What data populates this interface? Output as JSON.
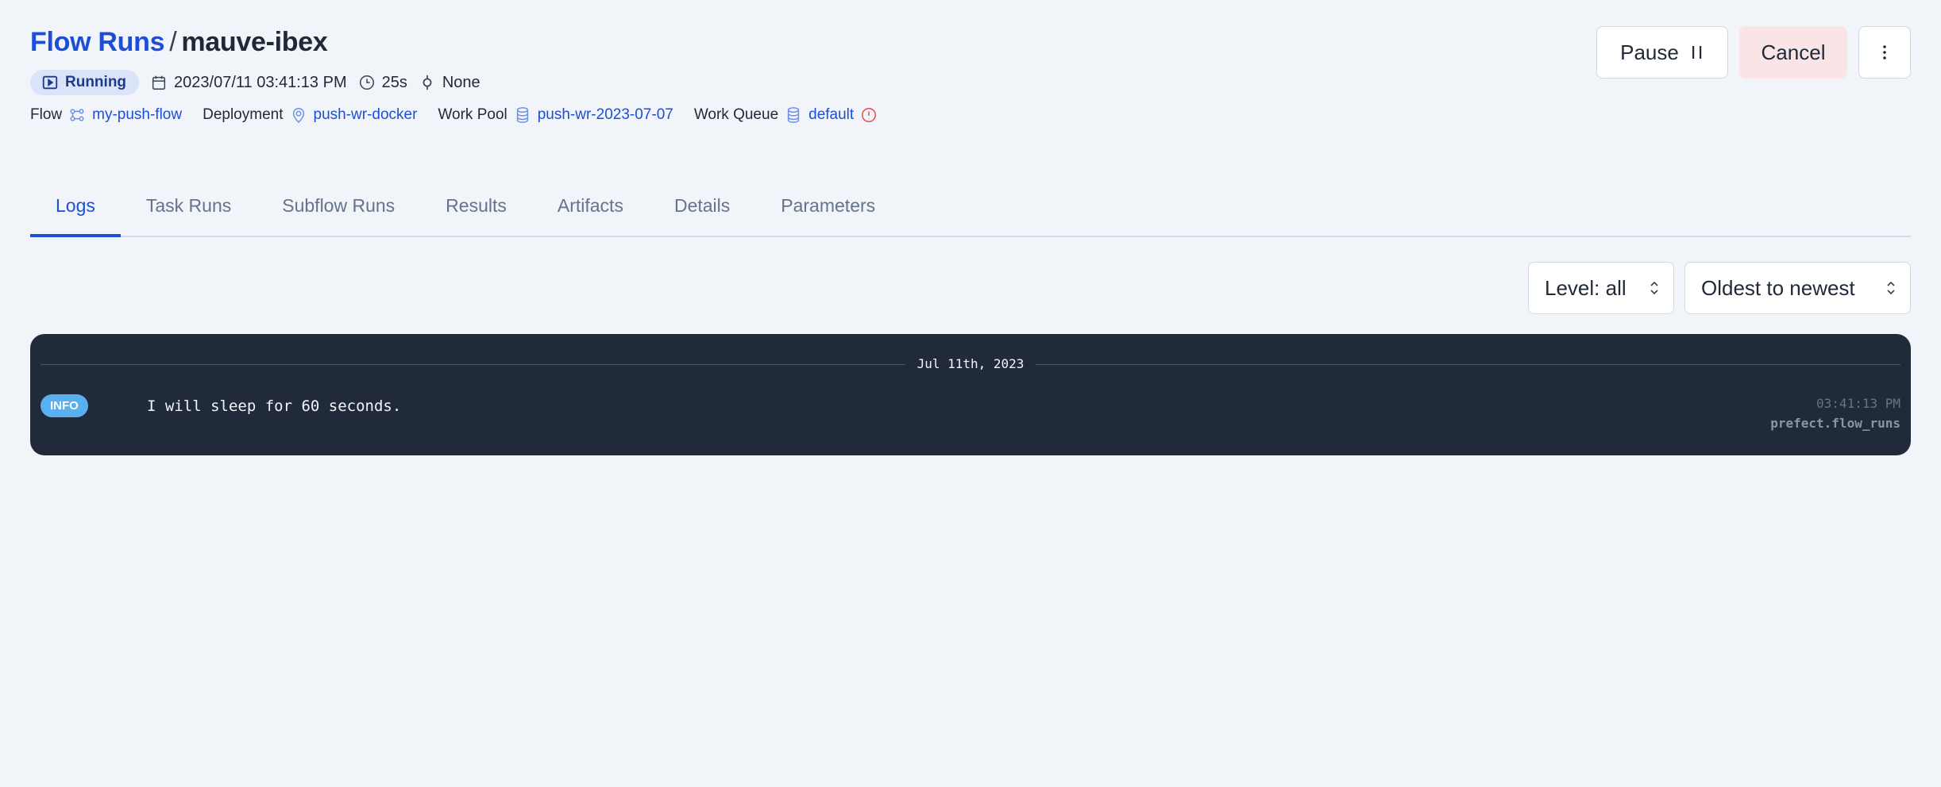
{
  "breadcrumb": {
    "parent": "Flow Runs",
    "separator": "/",
    "current": "mauve-ibex"
  },
  "run_meta": {
    "state": "Running",
    "start_time": "2023/07/11 03:41:13 PM",
    "duration": "25s",
    "tags": "None"
  },
  "relations": {
    "flow_label": "Flow",
    "flow_value": "my-push-flow",
    "deployment_label": "Deployment",
    "deployment_value": "push-wr-docker",
    "work_pool_label": "Work Pool",
    "work_pool_value": "push-wr-2023-07-07",
    "work_queue_label": "Work Queue",
    "work_queue_value": "default"
  },
  "actions": {
    "pause_label": "Pause",
    "cancel_label": "Cancel",
    "more_label": "⋮"
  },
  "tabs": [
    {
      "label": "Logs",
      "active": true
    },
    {
      "label": "Task Runs"
    },
    {
      "label": "Subflow Runs"
    },
    {
      "label": "Results"
    },
    {
      "label": "Artifacts"
    },
    {
      "label": "Details"
    },
    {
      "label": "Parameters"
    }
  ],
  "filters": {
    "level_value": "Level: all",
    "order_value": "Oldest to newest"
  },
  "logs": {
    "date_divider": "Jul 11th, 2023",
    "entries": [
      {
        "level": "INFO",
        "message": "I will sleep for 60 seconds.",
        "timestamp": "03:41:13 PM",
        "logger": "prefect.flow_runs"
      }
    ]
  },
  "colors": {
    "accent": "#1d4ed8",
    "background": "#f1f4f9",
    "log_panel": "#212a3b",
    "info_badge": "#5ab0ee",
    "cancel_bg": "#fae4e6",
    "state_badge_bg": "#dbe3f8",
    "warning": "#e5484d"
  }
}
